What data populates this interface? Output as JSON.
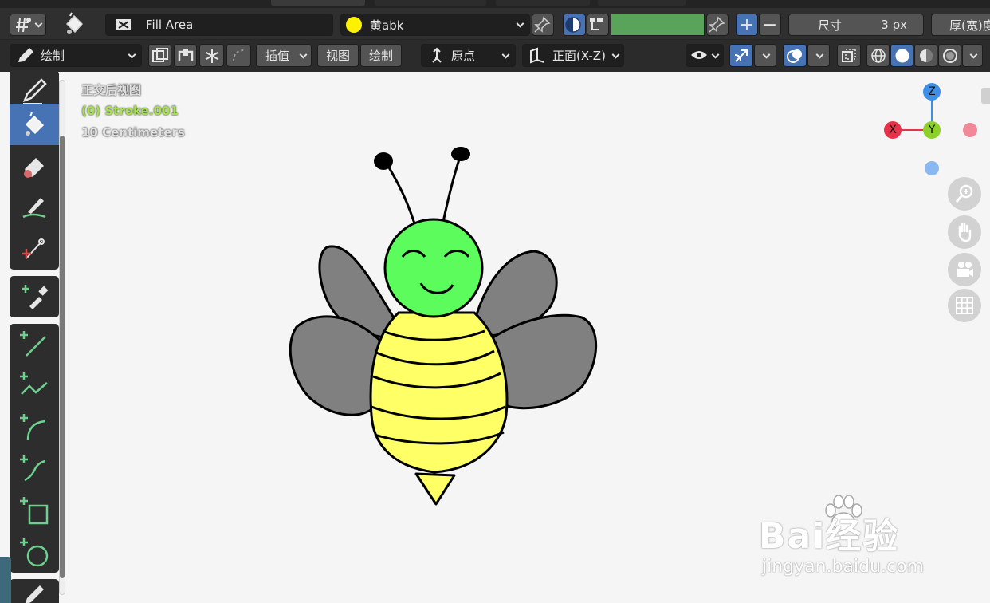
{
  "header": {
    "layer_name": "Fill Area",
    "material_name": "黄abk",
    "material_color": "#fff200",
    "stroke_color": "#5aa35a",
    "size_label": "尺寸",
    "size_value": "3 px",
    "thickness_label": "厚(宽)度"
  },
  "toolbar2": {
    "mode_label": "绘制",
    "interpolate_label": "插值",
    "view_label": "视图",
    "draw_label": "绘制",
    "pivot_label": "原点",
    "orientation_label": "正面(X-Z)"
  },
  "viewport": {
    "view_name": "正交后视图",
    "object_name": "(0) Stroke.001",
    "scale_text": "10 Centimeters",
    "object_color": "#a6e24a"
  },
  "gizmo": {
    "z": "Z",
    "y": "Y",
    "x": "X"
  },
  "tools": [
    "draw-tool",
    "fill-tool",
    "erase-tool",
    "tint-tool",
    "cutter-tool",
    "eyedropper-tool",
    "line-tool",
    "polyline-tool",
    "arc-tool",
    "curve-tool",
    "box-tool",
    "circle-tool",
    "annotate-tool"
  ],
  "nav_icons": [
    "zoom-icon",
    "hand-pan-icon",
    "camera-icon",
    "grid-ortho-icon"
  ],
  "drawing": {
    "subject": "bee",
    "head_color": "#5cfc5c",
    "body_color": "#ffff66",
    "wing_color": "#808080",
    "outline_color": "#000000"
  },
  "watermark": {
    "brand": "Bai经验",
    "url": "jingyan.baidu.com"
  }
}
